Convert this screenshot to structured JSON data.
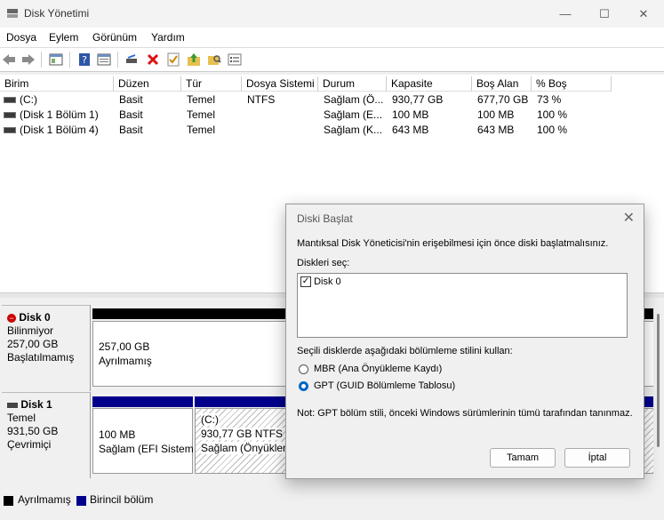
{
  "window": {
    "title": "Disk Yönetimi",
    "minimize": "—",
    "maximize": "☐",
    "close": "✕"
  },
  "menu": [
    "Dosya",
    "Eylem",
    "Görünüm",
    "Yardım"
  ],
  "volume_table": {
    "headers": [
      "Birim",
      "Düzen",
      "Tür",
      "Dosya Sistemi",
      "Durum",
      "Kapasite",
      "Boş Alan",
      "% Boş"
    ],
    "rows": [
      [
        "(C:)",
        "Basit",
        "Temel",
        "NTFS",
        "Sağlam (Ö...",
        "930,77 GB",
        "677,70 GB",
        "73 %"
      ],
      [
        "(Disk 1 Bölüm 1)",
        "Basit",
        "Temel",
        "",
        "Sağlam (E...",
        "100 MB",
        "100 MB",
        "100 %"
      ],
      [
        "(Disk 1 Bölüm 4)",
        "Basit",
        "Temel",
        "",
        "Sağlam (K...",
        "643 MB",
        "643 MB",
        "100 %"
      ]
    ]
  },
  "disks": [
    {
      "name": "Disk 0",
      "type": "Bilinmiyor",
      "size": "257,00 GB",
      "status": "Başlatılmamış",
      "partition": {
        "size": "257,00 GB",
        "label": "Ayrılmamış"
      }
    },
    {
      "name": "Disk 1",
      "type": "Temel",
      "size": "931,50 GB",
      "status": "Çevrimiçi",
      "partitions": [
        {
          "size": "100 MB",
          "label": "Sağlam (EFI Sistem"
        },
        {
          "name": "(C:)",
          "size": "930,77 GB NTFS",
          "label": "Sağlam (Önyüklen"
        }
      ]
    }
  ],
  "legend": {
    "unallocated": "Ayrılmamış",
    "primary": "Birincil bölüm"
  },
  "colors": {
    "primary": "#00008b",
    "unallocated": "#000000",
    "accent": "#0067c0"
  },
  "dialog": {
    "title": "Diski Başlat",
    "intro": "Mantıksal Disk Yöneticisi'nin erişebilmesi için önce diski başlatmalısınız.",
    "select_label": "Diskleri seç:",
    "disk_item": "Disk 0",
    "style_label": "Seçili disklerde aşağıdaki bölümleme stilini kullan:",
    "option_mbr": "MBR (Ana Önyükleme Kaydı)",
    "option_gpt": "GPT (GUID Bölümleme Tablosu)",
    "note": "Not: GPT bölüm stili, önceki Windows sürümlerinin tümü tarafından tanınmaz.",
    "ok": "Tamam",
    "cancel": "İptal"
  }
}
